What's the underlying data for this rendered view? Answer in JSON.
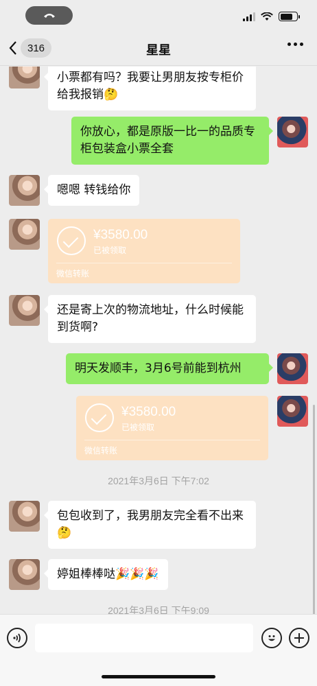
{
  "nav": {
    "unread_count": "316",
    "title": "星星"
  },
  "messages": [
    {
      "id": "m1",
      "side": "left",
      "text": "小票都有吗？我要让男朋友按专柜价给我报销",
      "emoji": "🤔"
    },
    {
      "id": "m2",
      "side": "right",
      "text": "你放心，都是原版一比一的品质专柜包装盒小票全套"
    },
    {
      "id": "m3",
      "side": "left",
      "text": "嗯嗯 转钱给你"
    },
    {
      "id": "m4",
      "side": "left",
      "type": "transfer",
      "amount": "¥3580.00",
      "status": "已被领取",
      "footer": "微信转账"
    },
    {
      "id": "m5",
      "side": "left",
      "text": "还是寄上次的物流地址，什么时候能到货啊?"
    },
    {
      "id": "m6",
      "side": "right",
      "text": "明天发顺丰，3月6号前能到杭州"
    },
    {
      "id": "m7",
      "side": "right",
      "type": "transfer",
      "amount": "¥3580.00",
      "status": "已被领取",
      "footer": "微信转账"
    },
    {
      "id": "m8",
      "side": "left",
      "text": "包包收到了，我男朋友完全看不出来",
      "emoji": "🤔"
    },
    {
      "id": "m9",
      "side": "left",
      "text": "婷姐棒棒哒",
      "emoji": "🎉🎉🎉"
    }
  ],
  "timestamps": [
    "2021年3月6日 下午7:02",
    "2021年3月6日 下午9:09"
  ],
  "colors": {
    "background": "#ededed",
    "bubble_mine": "#95ec69",
    "bubble_other": "#ffffff",
    "transfer_received": "#fde1c2"
  },
  "icons": [
    "phone-icon",
    "signal-icon",
    "wifi-icon",
    "battery-icon",
    "back-chevron-icon",
    "more-icon",
    "voice-icon",
    "emoji-icon",
    "plus-icon",
    "check-icon"
  ]
}
